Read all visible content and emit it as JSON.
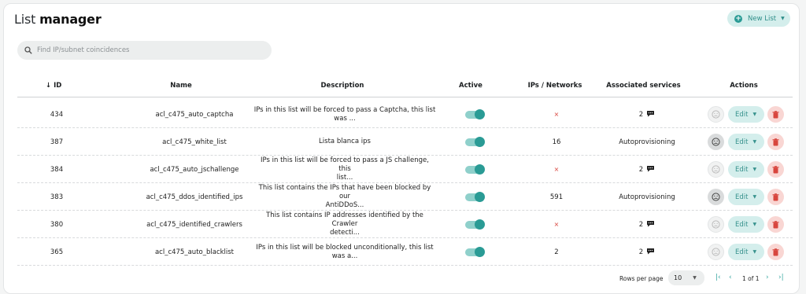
{
  "header": {
    "title_light": "List",
    "title_bold": "manager",
    "new_list_label": "New List"
  },
  "search": {
    "placeholder": "Find IP/subnet coincidences"
  },
  "table": {
    "columns": {
      "id": "ID",
      "name": "Name",
      "description": "Description",
      "active": "Active",
      "ips": "IPs / Networks",
      "services": "Associated services",
      "actions": "Actions"
    },
    "sort": {
      "column": "ID",
      "direction": "descending",
      "icon": "arrow-down-icon"
    },
    "rows": [
      {
        "id": "434",
        "name": "acl_c475_auto_captcha",
        "desc1": "IPs in this list will be forced to pass a Captcha, this list",
        "desc2": "was ...",
        "ips": "×",
        "services": "2",
        "edit": "Edit"
      },
      {
        "id": "387",
        "name": "acl_c475_white_list",
        "desc1": "Lista blanca ips",
        "desc2": "",
        "ips": "16",
        "services": "Autoprovisioning",
        "edit": "Edit"
      },
      {
        "id": "384",
        "name": "acl_c475_auto_jschallenge",
        "desc1": "IPs in this list will be forced to pass a JS challenge, this",
        "desc2": "list...",
        "ips": "×",
        "services": "2",
        "edit": "Edit"
      },
      {
        "id": "383",
        "name": "acl_c475_ddos_identified_ips",
        "desc1": "This list contains the IPs that have been blocked by our",
        "desc2": "AntiDDoS...",
        "ips": "591",
        "services": "Autoprovisioning",
        "edit": "Edit"
      },
      {
        "id": "380",
        "name": "acl_c475_identified_crawlers",
        "desc1": "This list contains IP addresses identified by the Crawler",
        "desc2": "detecti...",
        "ips": "×",
        "services": "2",
        "edit": "Edit"
      },
      {
        "id": "365",
        "name": "acl_c475_auto_blacklist",
        "desc1": "IPs in this list will be blocked unconditionally, this list",
        "desc2": "was a...",
        "ips": "2",
        "services": "2",
        "edit": "Edit"
      }
    ]
  },
  "pagination": {
    "rows_per_page_label": "Rows per page",
    "rows_per_page_value": "10",
    "range": "1 of 1"
  },
  "colors": {
    "accent": "#2a9b95",
    "accent_light": "#d4eeec",
    "danger": "#d8453d",
    "danger_light": "#f9d6d3"
  }
}
